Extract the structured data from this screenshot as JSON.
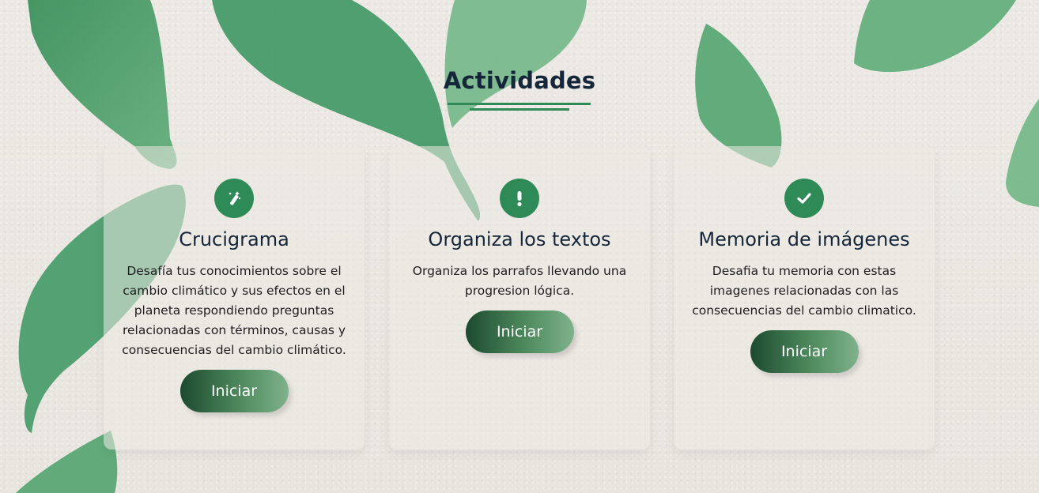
{
  "section": {
    "title": "Actividades"
  },
  "colors": {
    "accent": "#2e8b57",
    "title_text": "#16263a",
    "button_gradient_start": "#1d4a30",
    "button_gradient_end": "#7fb28c",
    "background": "#ebe8e3"
  },
  "activities": [
    {
      "icon": "magic-wand-icon",
      "title": "Crucigrama",
      "description": "Desafía tus conocimientos sobre el cambio climático y sus efectos en el planeta respondiendo preguntas relacionadas con términos, causas y consecuencias del cambio climático.",
      "button_label": "Iniciar"
    },
    {
      "icon": "exclamation-icon",
      "title": "Organiza los textos",
      "description": "Organiza los parrafos llevando una progresion lógica.",
      "button_label": "Iniciar"
    },
    {
      "icon": "checkmark-icon",
      "title": "Memoria de imágenes",
      "description": "Desafia tu memoria con estas imagenes relacionadas con las consecuencias del cambio climatico.",
      "button_label": "Iniciar"
    }
  ]
}
